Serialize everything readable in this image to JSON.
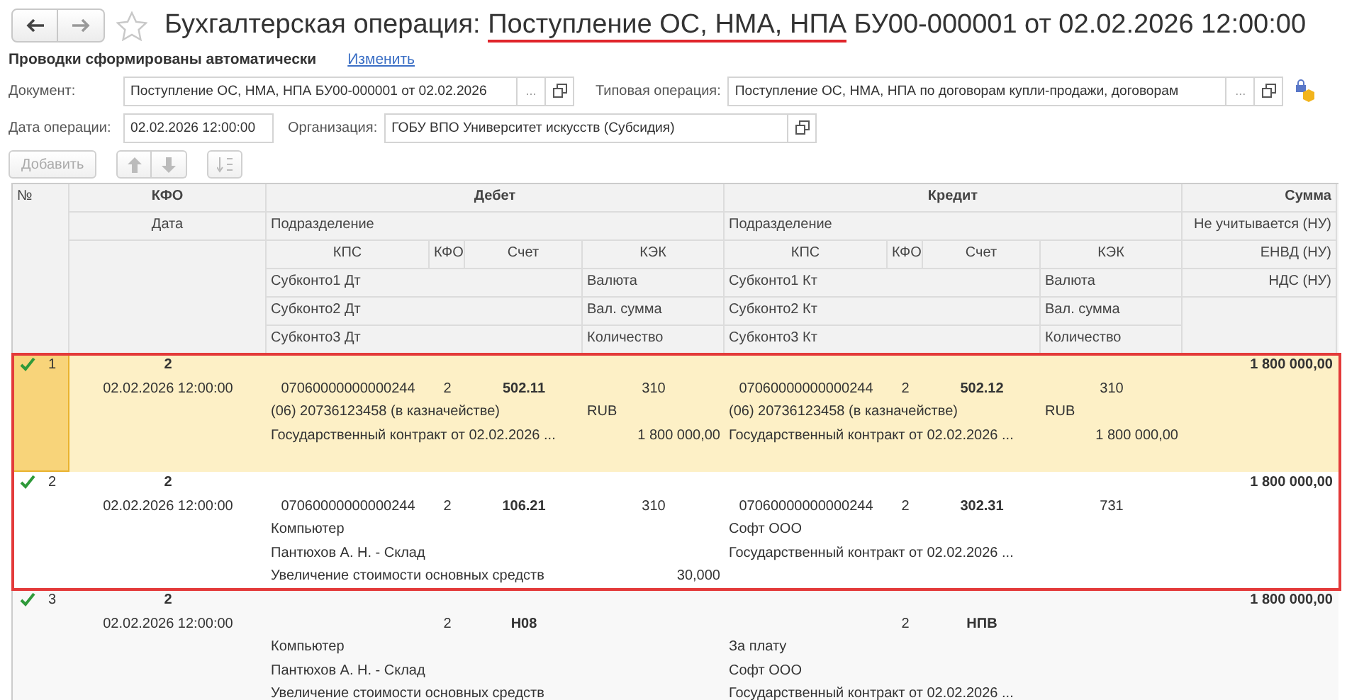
{
  "title_parts": [
    {
      "text": "Бухгалтерская операция: ",
      "underlined": false
    },
    {
      "text": "Поступление ОС, НМА, НПА",
      "underlined": true
    },
    {
      "text": " БУ00-000001 от 02.02.2026 12:00:00",
      "underlined": false
    }
  ],
  "auto_note": "Проводки сформированы автоматически",
  "change_link": "Изменить",
  "fields": {
    "document": {
      "label": "Документ:",
      "value": "Поступление ОС, НМА, НПА БУ00-000001 от 02.02.2026",
      "select": "..."
    },
    "operation_type": {
      "label": "Типовая операция:",
      "value": "Поступление ОС, НМА, НПА по договорам купли-продажи, договорам",
      "select": "..."
    },
    "date": {
      "label": "Дата операции:",
      "value": "02.02.2026 12:00:00"
    },
    "organization": {
      "label": "Организация:",
      "value": "ГОБУ ВПО Университет искусств (Субсидия)"
    }
  },
  "toolbar": {
    "add": "Добавить",
    "add_disabled": true,
    "move_disabled": true
  },
  "table": {
    "header": {
      "num": "№",
      "kfo": "КФО",
      "date": "Дата",
      "debit": {
        "title": "Дебет",
        "division": "Подразделение",
        "kps": "КПС",
        "kfo": "КФО",
        "account": "Счет",
        "kek": "КЭК",
        "sub1": "Субконто1 Дт",
        "currency": "Валюта",
        "sub2": "Субконто2 Дт",
        "cur_amount": "Вал. сумма",
        "sub3": "Субконто3 Дт",
        "quantity": "Количество"
      },
      "credit": {
        "title": "Кредит",
        "division": "Подразделение",
        "kps": "КПС",
        "kfo": "КФО",
        "account": "Счет",
        "kek": "КЭК",
        "sub1": "Субконто1 Кт",
        "currency": "Валюта",
        "sub2": "Субконто2 Кт",
        "cur_amount": "Вал. сумма",
        "sub3": "Субконто3 Кт",
        "quantity": "Количество"
      },
      "sum": {
        "title": "Сумма",
        "line2": "Не учитывается (НУ)",
        "line3": "ЕНВД (НУ)",
        "line4": "НДС (НУ)"
      }
    },
    "rows": [
      {
        "posted": true,
        "selected": true,
        "outlined": true,
        "num": "1",
        "kfo": "2",
        "date": "02.02.2026 12:00:00",
        "sum": "1 800 000,00",
        "debit": {
          "kps": "07060000000000244",
          "kfo": "2",
          "account": "502.11",
          "kek": "310",
          "sub1": "(06) 20736123458 (в казначействе)",
          "currency": "RUB",
          "sub2": "Государственный контракт от 02.02.2026 ...",
          "cur_amount": "1 800 000,00"
        },
        "credit": {
          "kps": "07060000000000244",
          "kfo": "2",
          "account": "502.12",
          "kek": "310",
          "sub1": "(06) 20736123458 (в казначействе)",
          "currency": "RUB",
          "sub2": "Государственный контракт от 02.02.2026 ...",
          "cur_amount": "1 800 000,00"
        }
      },
      {
        "posted": true,
        "selected": false,
        "outlined": true,
        "num": "2",
        "kfo": "2",
        "date": "02.02.2026 12:00:00",
        "sum": "1 800 000,00",
        "debit": {
          "kps": "07060000000000244",
          "kfo": "2",
          "account": "106.21",
          "kek": "310",
          "sub1": "Компьютер",
          "sub2": "Пантюхов А. Н. - Склад",
          "sub3": "Увеличение стоимости основных средств",
          "quantity": "30,000"
        },
        "credit": {
          "kps": "07060000000000244",
          "kfo": "2",
          "account": "302.31",
          "kek": "731",
          "sub1": "Софт ООО",
          "sub2": "Государственный контракт от 02.02.2026 ..."
        }
      },
      {
        "posted": true,
        "selected": false,
        "outlined": false,
        "num": "3",
        "kfo": "2",
        "date": "02.02.2026 12:00:00",
        "sum": "1 800 000,00",
        "debit": {
          "kfo": "2",
          "account": "Н08",
          "sub1": "Компьютер",
          "sub2": "Пантюхов А. Н. - Склад",
          "sub3": "Увеличение стоимости основных средств"
        },
        "credit": {
          "kfo": "2",
          "account": "НПВ",
          "sub1": "За плату",
          "sub2": "Софт ООО",
          "sub3": "Государственный контракт от 02.02.2026 ..."
        }
      }
    ]
  }
}
